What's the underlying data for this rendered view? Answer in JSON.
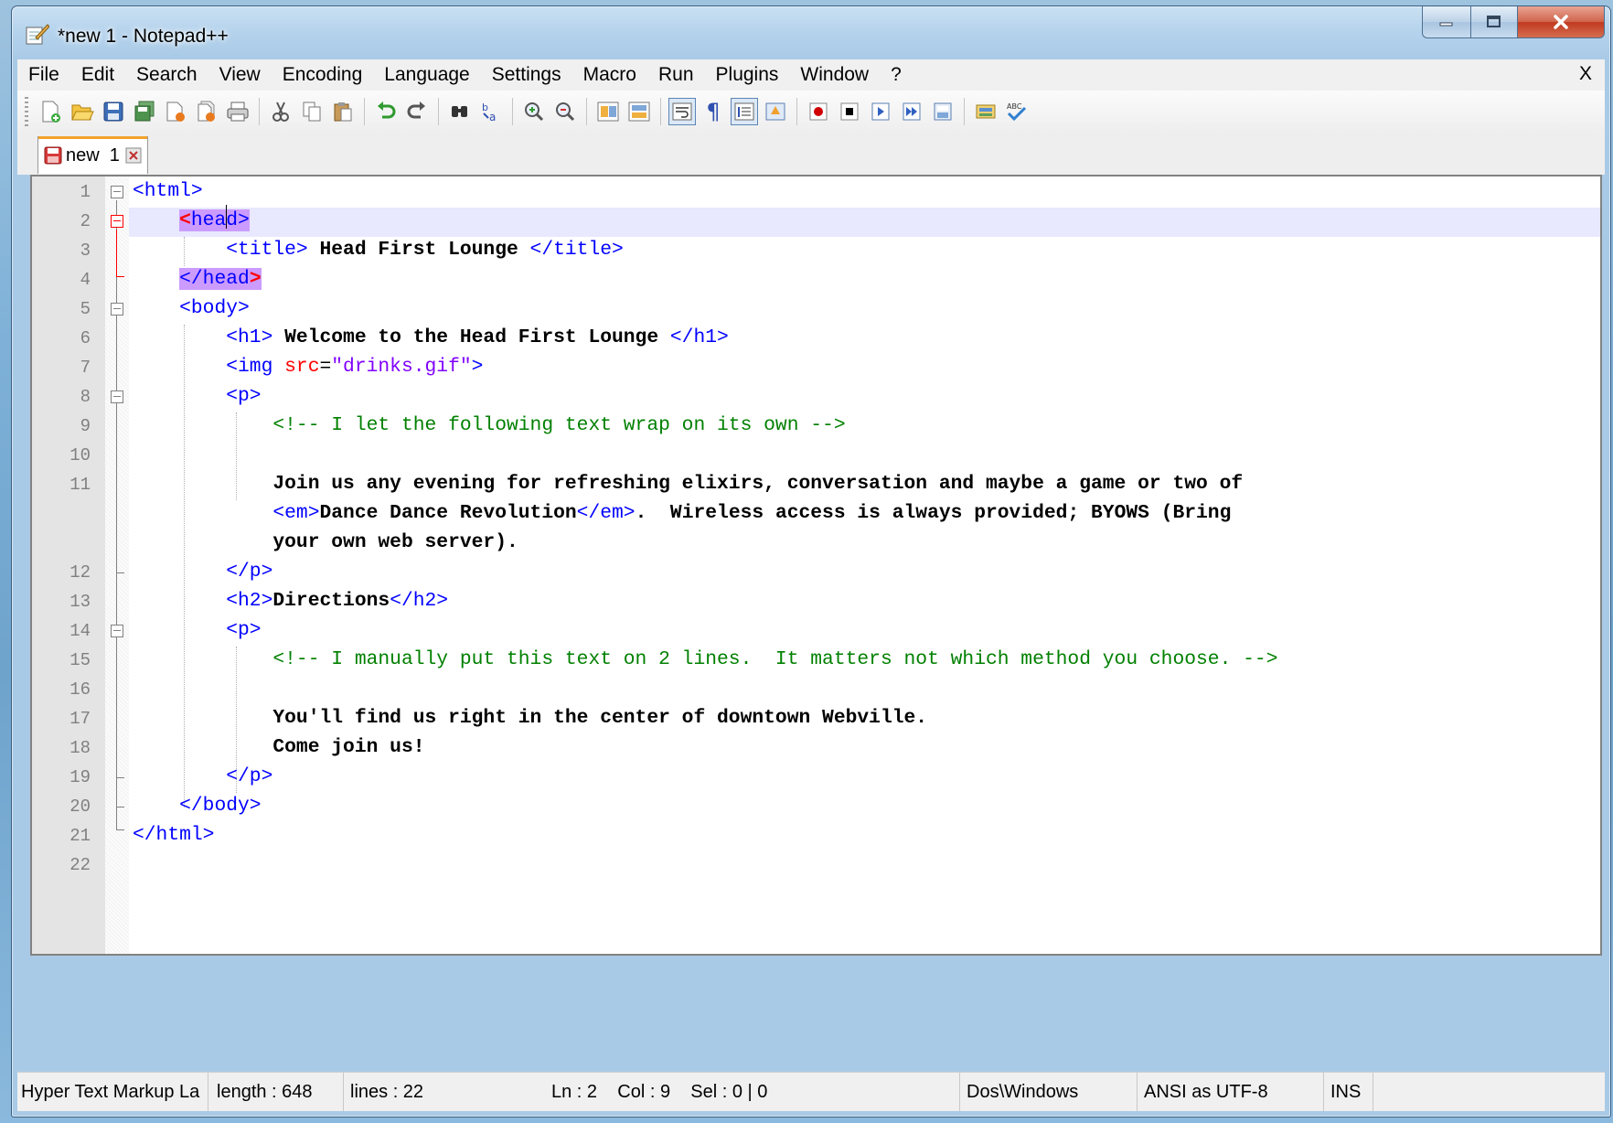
{
  "window": {
    "title": "*new  1 - Notepad++",
    "min_icon": "minimize-icon",
    "max_icon": "maximize-icon",
    "close_icon": "close-icon"
  },
  "menu": {
    "items": [
      "File",
      "Edit",
      "Search",
      "View",
      "Encoding",
      "Language",
      "Settings",
      "Macro",
      "Run",
      "Plugins",
      "Window",
      "?"
    ],
    "close_label": "X"
  },
  "toolbar": {
    "icons": [
      "new-file-icon",
      "open-file-icon",
      "save-icon",
      "save-all-icon",
      "close-icon",
      "close-all-icon",
      "print-icon",
      "cut-icon",
      "copy-icon",
      "paste-icon",
      "undo-icon",
      "redo-icon",
      "find-icon",
      "replace-icon",
      "zoom-in-icon",
      "zoom-out-icon",
      "sync-vertical-icon",
      "sync-horizontal-icon",
      "word-wrap-icon",
      "show-all-characters-icon",
      "indent-guide-icon",
      "user-language-icon",
      "record-macro-icon",
      "stop-recording-icon",
      "playback-macro-icon",
      "run-macro-multiple-icon",
      "save-macro-icon",
      "launch-browser-icon",
      "spell-check-icon"
    ]
  },
  "tab": {
    "label": "new  1",
    "icon": "unsaved-file-icon",
    "close_icon": "tab-close-icon"
  },
  "editor": {
    "lines": [
      {
        "n": "1"
      },
      {
        "n": "2"
      },
      {
        "n": "3"
      },
      {
        "n": "4"
      },
      {
        "n": "5"
      },
      {
        "n": "6"
      },
      {
        "n": "7"
      },
      {
        "n": "8"
      },
      {
        "n": "9"
      },
      {
        "n": "10"
      },
      {
        "n": "11"
      },
      {
        "n": "12"
      },
      {
        "n": "13"
      },
      {
        "n": "14"
      },
      {
        "n": "15"
      },
      {
        "n": "16"
      },
      {
        "n": "17"
      },
      {
        "n": "18"
      },
      {
        "n": "19"
      },
      {
        "n": "20"
      },
      {
        "n": "21"
      },
      {
        "n": "22"
      }
    ],
    "code": {
      "l1_open": "<html>",
      "l2_lt": "<",
      "l2_name_a": "hea",
      "l2_name_b": "d>",
      "l3_open": "<title>",
      "l3_text": " Head First Lounge ",
      "l3_close": "</title>",
      "l4_close": "</head",
      "l4_gt": ">",
      "l5_open": "<body>",
      "l6_open": "<h1>",
      "l6_text": " Welcome to the Head First Lounge ",
      "l6_close": "</h1>",
      "l7_open": "<img ",
      "l7_attr": "src",
      "l7_eq": "=",
      "l7_val": "\"drinks.gif\"",
      "l7_end": ">",
      "l8_open": "<p>",
      "l9_comment": "<!-- I let the following text wrap on its own -->",
      "l11_text": "Join us any evening for refreshing elixirs, conversation and maybe a game or two of",
      "l11b_open": "<em>",
      "l11b_text": "Dance Dance Revolution",
      "l11b_close": "</em>",
      "l11b_tail": ".  Wireless access is always provided; BYOWS (Bring",
      "l11c_text": "your own web server).",
      "l12_close": "</p>",
      "l13_open": "<h2>",
      "l13_text": "Directions",
      "l13_close": "</h2>",
      "l14_open": "<p>",
      "l15_comment": "<!-- I manually put this text on 2 lines.  It matters not which method you choose. -->",
      "l17_text": "You'll find us right in the center of downtown Webville.",
      "l18_text": "Come join us!",
      "l19_close": "</p>",
      "l20_close": "</body>",
      "l21_close": "</html>"
    }
  },
  "status": {
    "language": "Hyper Text Markup La",
    "length": "length : 648",
    "lines": "lines : 22",
    "position": "Ln : 2    Col : 9    Sel : 0 | 0",
    "eol": "Dos\\Windows",
    "encoding": "ANSI as UTF-8",
    "mode": "INS"
  }
}
